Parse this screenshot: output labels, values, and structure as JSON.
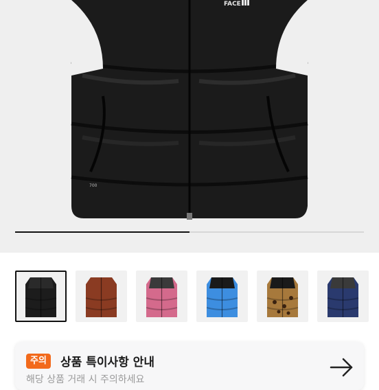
{
  "hero": {
    "brand_text": "FACE",
    "product_mark": "700",
    "carousel_progress": 0.5
  },
  "thumbnails": [
    {
      "name": "black",
      "color": "#1c1c1c",
      "accent": "#2a2a2a",
      "selected": true
    },
    {
      "name": "brown",
      "color": "#8a3b22",
      "accent": "#8a3b22",
      "selected": false
    },
    {
      "name": "pink",
      "color": "#d46a8c",
      "accent": "#3a3a3a",
      "selected": false
    },
    {
      "name": "blue",
      "color": "#3d8ee0",
      "accent": "#1a1a1a",
      "selected": false
    },
    {
      "name": "leopard",
      "color": "#a7793c",
      "accent": "#1a1a1a",
      "selected": false
    },
    {
      "name": "navy",
      "color": "#2a3a6e",
      "accent": "#3a3a3a",
      "selected": false
    }
  ],
  "notice": {
    "badge": "주의",
    "title": "상품 특이사항 안내",
    "subtitle": "해당 상품 거래 시 주의하세요",
    "arrow_icon": "arrow-right-icon"
  }
}
